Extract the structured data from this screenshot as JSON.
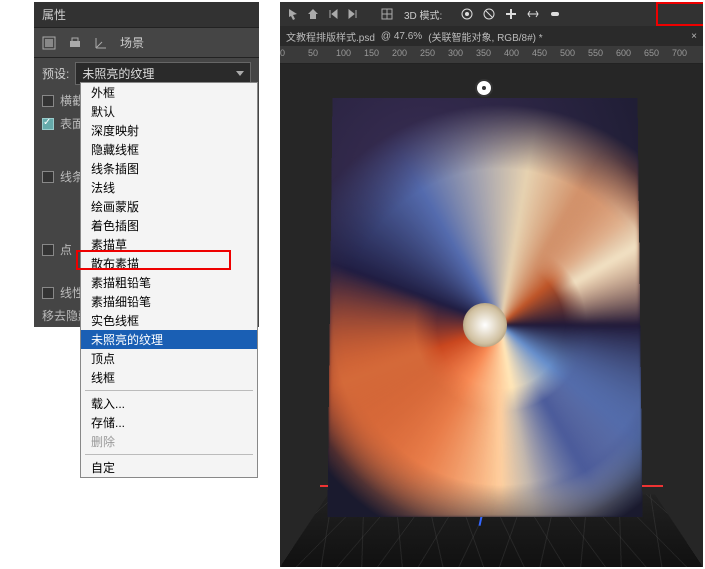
{
  "panel": {
    "title": "属性",
    "toolbar_scene": "场景",
    "preset_label": "预设:",
    "preset_value": "未照亮的纹理",
    "rows": {
      "crosssection": "横截",
      "surface": "表面",
      "line": "线条",
      "point": "点",
      "linetype": "线性",
      "remove_hidden": "移去隐藏"
    }
  },
  "dropdown": {
    "items": [
      "外框",
      "默认",
      "深度映射",
      "隐藏线框",
      "线条插图",
      "法线",
      "绘画蒙版",
      "着色插图",
      "素描草",
      "散布素描",
      "素描粗铅笔",
      "素描细铅笔",
      "实色线框",
      "未照亮的纹理",
      "顶点",
      "线框"
    ],
    "load": "载入...",
    "save": "存储...",
    "delete": "删除",
    "custom": "自定"
  },
  "viewport": {
    "mode_label": "3D 模式:",
    "tab_name": "文教程排版样式.psd",
    "tab_zoom": "@ 47.6%",
    "tab_layer": "(关联智能对象, RGB/8#) *",
    "ruler": [
      "0",
      "50",
      "100",
      "150",
      "200",
      "250",
      "300",
      "350",
      "400",
      "450",
      "500",
      "550",
      "600",
      "650",
      "700"
    ]
  }
}
